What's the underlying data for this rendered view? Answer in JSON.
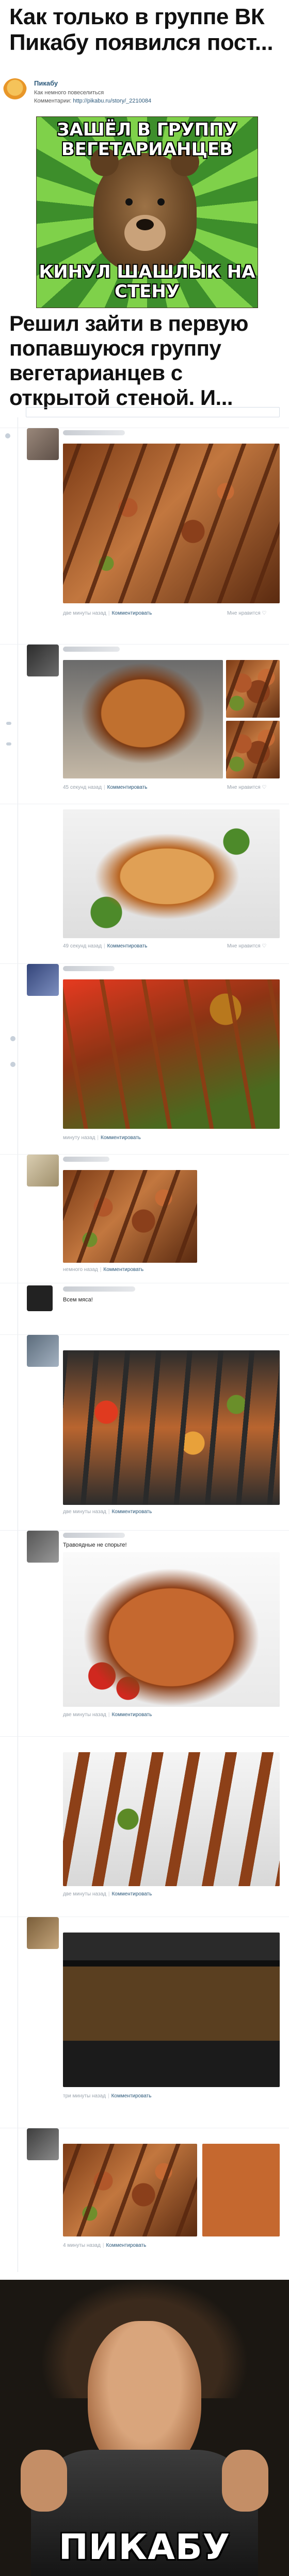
{
  "headline": "Как только в группе ВК Пикабу появился пост...",
  "vk_post": {
    "author": "Пикабу",
    "subtitle": "Как немного повеселиться",
    "comments_label": "Комментарии:",
    "comments_link": "http://pikabu.ru/story/_2210084"
  },
  "meme_top": {
    "top_text": "ЗАШЁЛ В ГРУППУ ВЕГЕТАРИАНЦЕВ",
    "bottom_text": "КИНУЛ ШАШЛЫК НА СТЕНУ"
  },
  "subheadline": "Решил зайти в первую попавшуюся группу вегетарианцев с открытой стеной. И...",
  "posts": [
    {
      "meta": "две минуты назад",
      "action": "Комментировать",
      "like": "Мне нравится",
      "like_icon": "heart-icon"
    },
    {
      "meta": "45 секунд назад",
      "action": "Комментировать",
      "like": "Мне нравится",
      "like_icon": "heart-icon"
    },
    {
      "meta": "49 секунд назад",
      "action": "Комментировать",
      "like": "Мне нравится",
      "like_icon": "heart-icon"
    },
    {
      "meta": "минуту назад",
      "action": "Комментировать"
    },
    {
      "meta": "немного назад",
      "action": "Комментировать"
    },
    {
      "text": "Всем мяса!"
    },
    {
      "meta": "две минуты назад",
      "action": "Комментировать"
    },
    {
      "text": "Травоядные не спорьте!",
      "meta": "две минуты назад",
      "action": "Комментировать"
    },
    {
      "meta": "две минуты назад",
      "action": "Комментировать"
    },
    {
      "meta": "три минуты назад",
      "action": "Комментировать"
    },
    {
      "meta": "4 минуты назад",
      "action": "Комментировать"
    }
  ],
  "bottom_meme": {
    "caption": "ПИКАБУ"
  }
}
